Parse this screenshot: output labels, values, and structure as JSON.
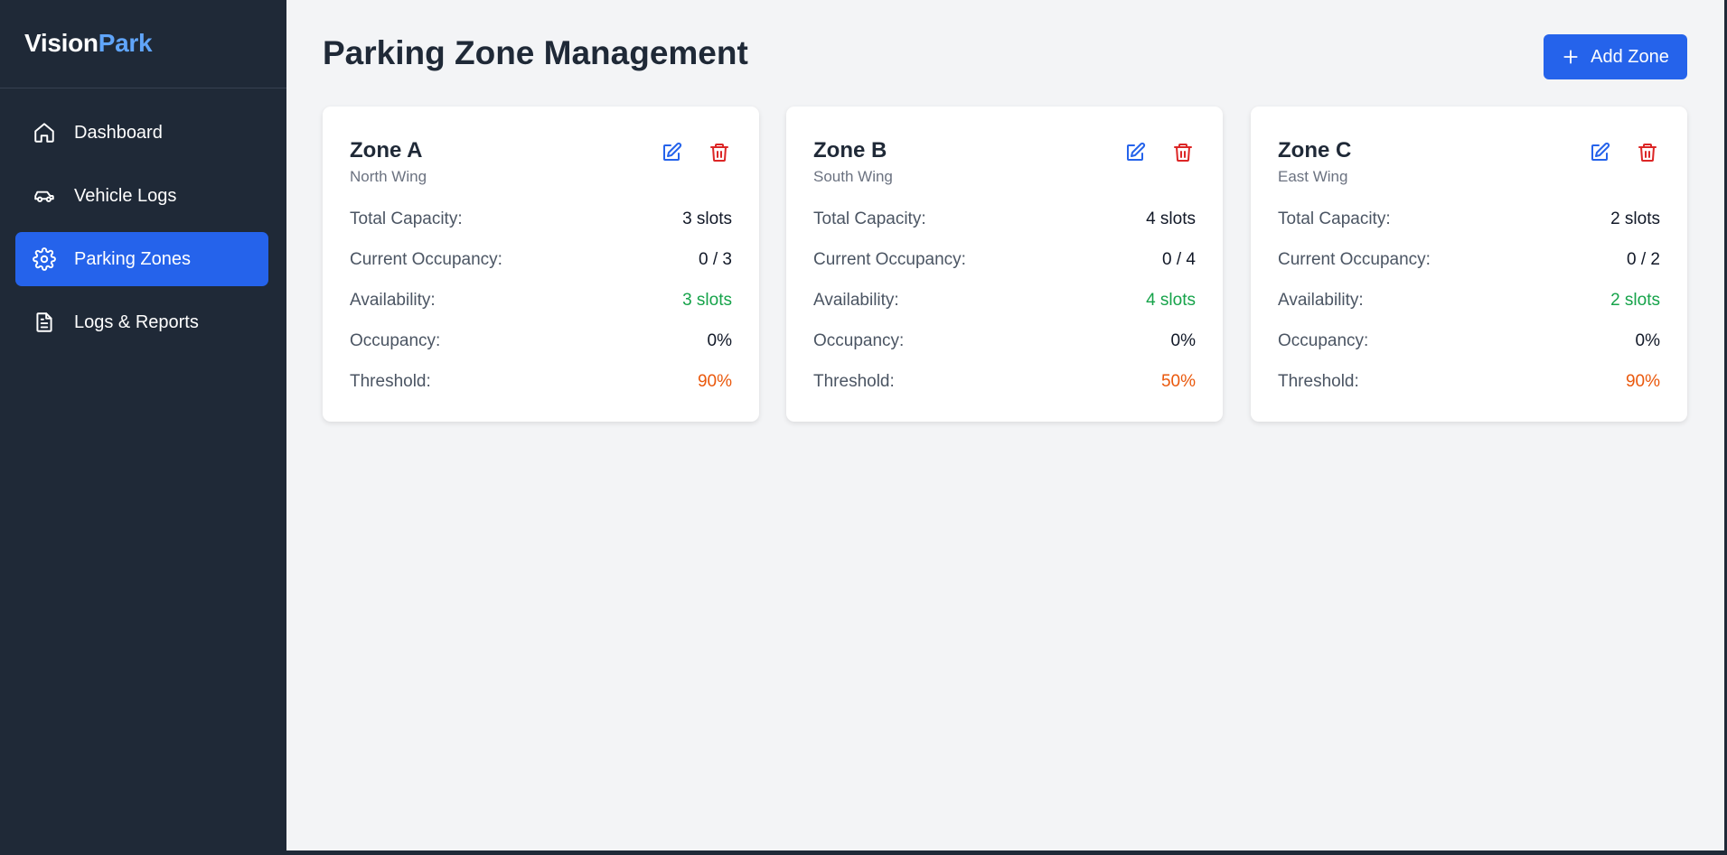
{
  "app": {
    "brand_main": "Vision",
    "brand_accent": "Park"
  },
  "sidebar": {
    "items": [
      {
        "label": "Dashboard",
        "icon": "home-icon",
        "active": false
      },
      {
        "label": "Vehicle Logs",
        "icon": "car-icon",
        "active": false
      },
      {
        "label": "Parking Zones",
        "icon": "gear-icon",
        "active": true
      },
      {
        "label": "Logs & Reports",
        "icon": "document-icon",
        "active": false
      }
    ]
  },
  "header": {
    "title": "Parking Zone Management",
    "add_label": "Add Zone"
  },
  "labels": {
    "capacity": "Total Capacity:",
    "occupancy": "Current Occupancy:",
    "availability": "Availability:",
    "occupancy_pct": "Occupancy:",
    "threshold": "Threshold:"
  },
  "zones": [
    {
      "name": "Zone A",
      "location": "North Wing",
      "capacity": "3 slots",
      "occupancy": "0 / 3",
      "availability": "3 slots",
      "occupancy_pct": "0%",
      "threshold": "90%"
    },
    {
      "name": "Zone B",
      "location": "South Wing",
      "capacity": "4 slots",
      "occupancy": "0 / 4",
      "availability": "4 slots",
      "occupancy_pct": "0%",
      "threshold": "50%"
    },
    {
      "name": "Zone C",
      "location": "East Wing",
      "capacity": "2 slots",
      "occupancy": "0 / 2",
      "availability": "2 slots",
      "occupancy_pct": "0%",
      "threshold": "90%"
    }
  ],
  "colors": {
    "sidebar_bg": "#1f2937",
    "accent": "#2563eb",
    "available": "#16a34a",
    "threshold": "#ea580c",
    "delete": "#dc2626"
  }
}
